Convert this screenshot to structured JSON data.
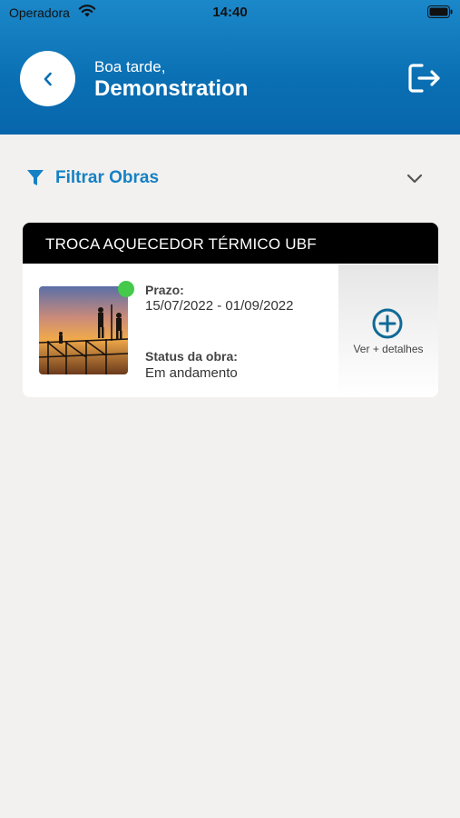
{
  "status_bar": {
    "carrier": "Operadora",
    "time": "14:40"
  },
  "header": {
    "greeting": "Boa tarde,",
    "username": "Demonstration"
  },
  "filter": {
    "label": "Filtrar Obras"
  },
  "obras": [
    {
      "title": "TROCA AQUECEDOR TÉRMICO UBF",
      "prazo_label": "Prazo:",
      "prazo_value": "15/07/2022 - 01/09/2022",
      "status_label": "Status da obra:",
      "status_value": "Em andamento",
      "details_label": "Ver + detalhes",
      "status_color": "#44c94a"
    }
  ],
  "colors": {
    "brand": "#0a6fb3",
    "accent_text": "#1581c4",
    "status_active": "#44c94a"
  },
  "icons": [
    "wifi-icon",
    "battery-icon",
    "chevron-left-icon",
    "logout-icon",
    "filter-icon",
    "chevron-down-icon",
    "plus-circle-icon"
  ]
}
